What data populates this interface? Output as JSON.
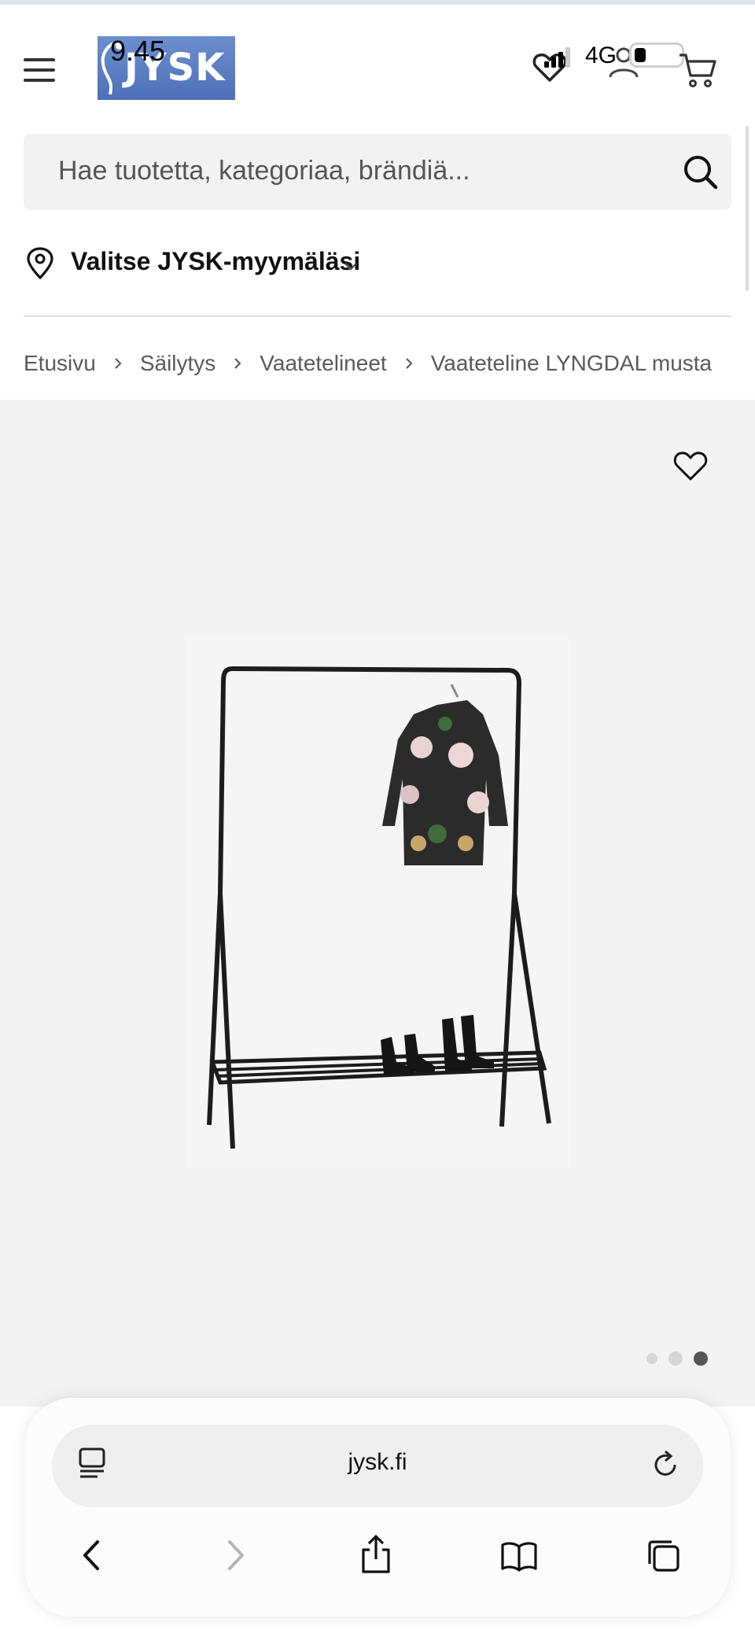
{
  "status_bar": {
    "time": "9.45",
    "network": "4G"
  },
  "header": {
    "logo_text": "JYSK",
    "menu_icon": "hamburger-icon",
    "wishlist_icon": "heart-icon",
    "account_icon": "user-icon",
    "cart_icon": "cart-icon"
  },
  "search": {
    "placeholder": "Hae tuotetta, kategoriaa, brändiä...",
    "icon": "search-icon"
  },
  "store_selector": {
    "label": "Valitse JYSK-myymäläsi",
    "icon": "location-pin-icon"
  },
  "breadcrumb": {
    "items": [
      "Etusivu",
      "Säilytys",
      "Vaatetelineet",
      "Vaateteline LYNGDAL musta"
    ]
  },
  "product": {
    "gallery_total": 3,
    "gallery_active_index": 3,
    "favorite_icon": "heart-outline-icon"
  },
  "browser": {
    "url": "jysk.fi",
    "reader_icon": "page-menu-icon",
    "reload_icon": "reload-icon",
    "nav_icons": [
      "back-icon",
      "forward-icon",
      "share-icon",
      "bookmarks-icon",
      "tabs-icon"
    ]
  },
  "colors": {
    "logo_blue": "#5a7bc0",
    "gallery_bg": "#f3f3f3",
    "search_bg": "#f2f2f2"
  }
}
